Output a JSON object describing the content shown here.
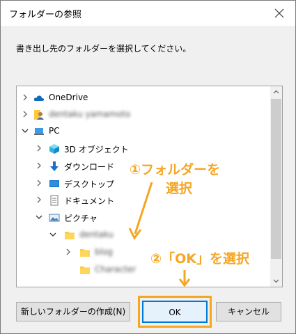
{
  "window": {
    "title": "フォルダーの参照"
  },
  "instruction": "書き出し先のフォルダーを選択してください。",
  "tree": {
    "items": [
      {
        "label": "OneDrive",
        "icon": "cloud-icon"
      },
      {
        "label": "dentaku yamamoto",
        "icon": "user-folder-icon"
      },
      {
        "label": "PC",
        "icon": "pc-icon"
      },
      {
        "label": "3D オブジェクト",
        "icon": "cube-icon"
      },
      {
        "label": "ダウンロード",
        "icon": "download-icon"
      },
      {
        "label": "デスクトップ",
        "icon": "desktop-icon"
      },
      {
        "label": "ドキュメント",
        "icon": "document-icon"
      },
      {
        "label": "ピクチャ",
        "icon": "pictures-icon"
      },
      {
        "label": "dentaku",
        "icon": "folder-icon"
      },
      {
        "label": "blog",
        "icon": "folder-icon"
      },
      {
        "label": "Character",
        "icon": "folder-icon"
      }
    ]
  },
  "buttons": {
    "new_folder": "新しいフォルダーの作成(N)",
    "ok": "OK",
    "cancel": "キャンセル"
  },
  "annotations": {
    "step1_line1": "①フォルダーを",
    "step1_line2": "選択",
    "step2": "②「OK」を選択"
  },
  "colors": {
    "annotation": "#f5a623",
    "accent": "#0078d7",
    "folder": "#ffc83d"
  }
}
